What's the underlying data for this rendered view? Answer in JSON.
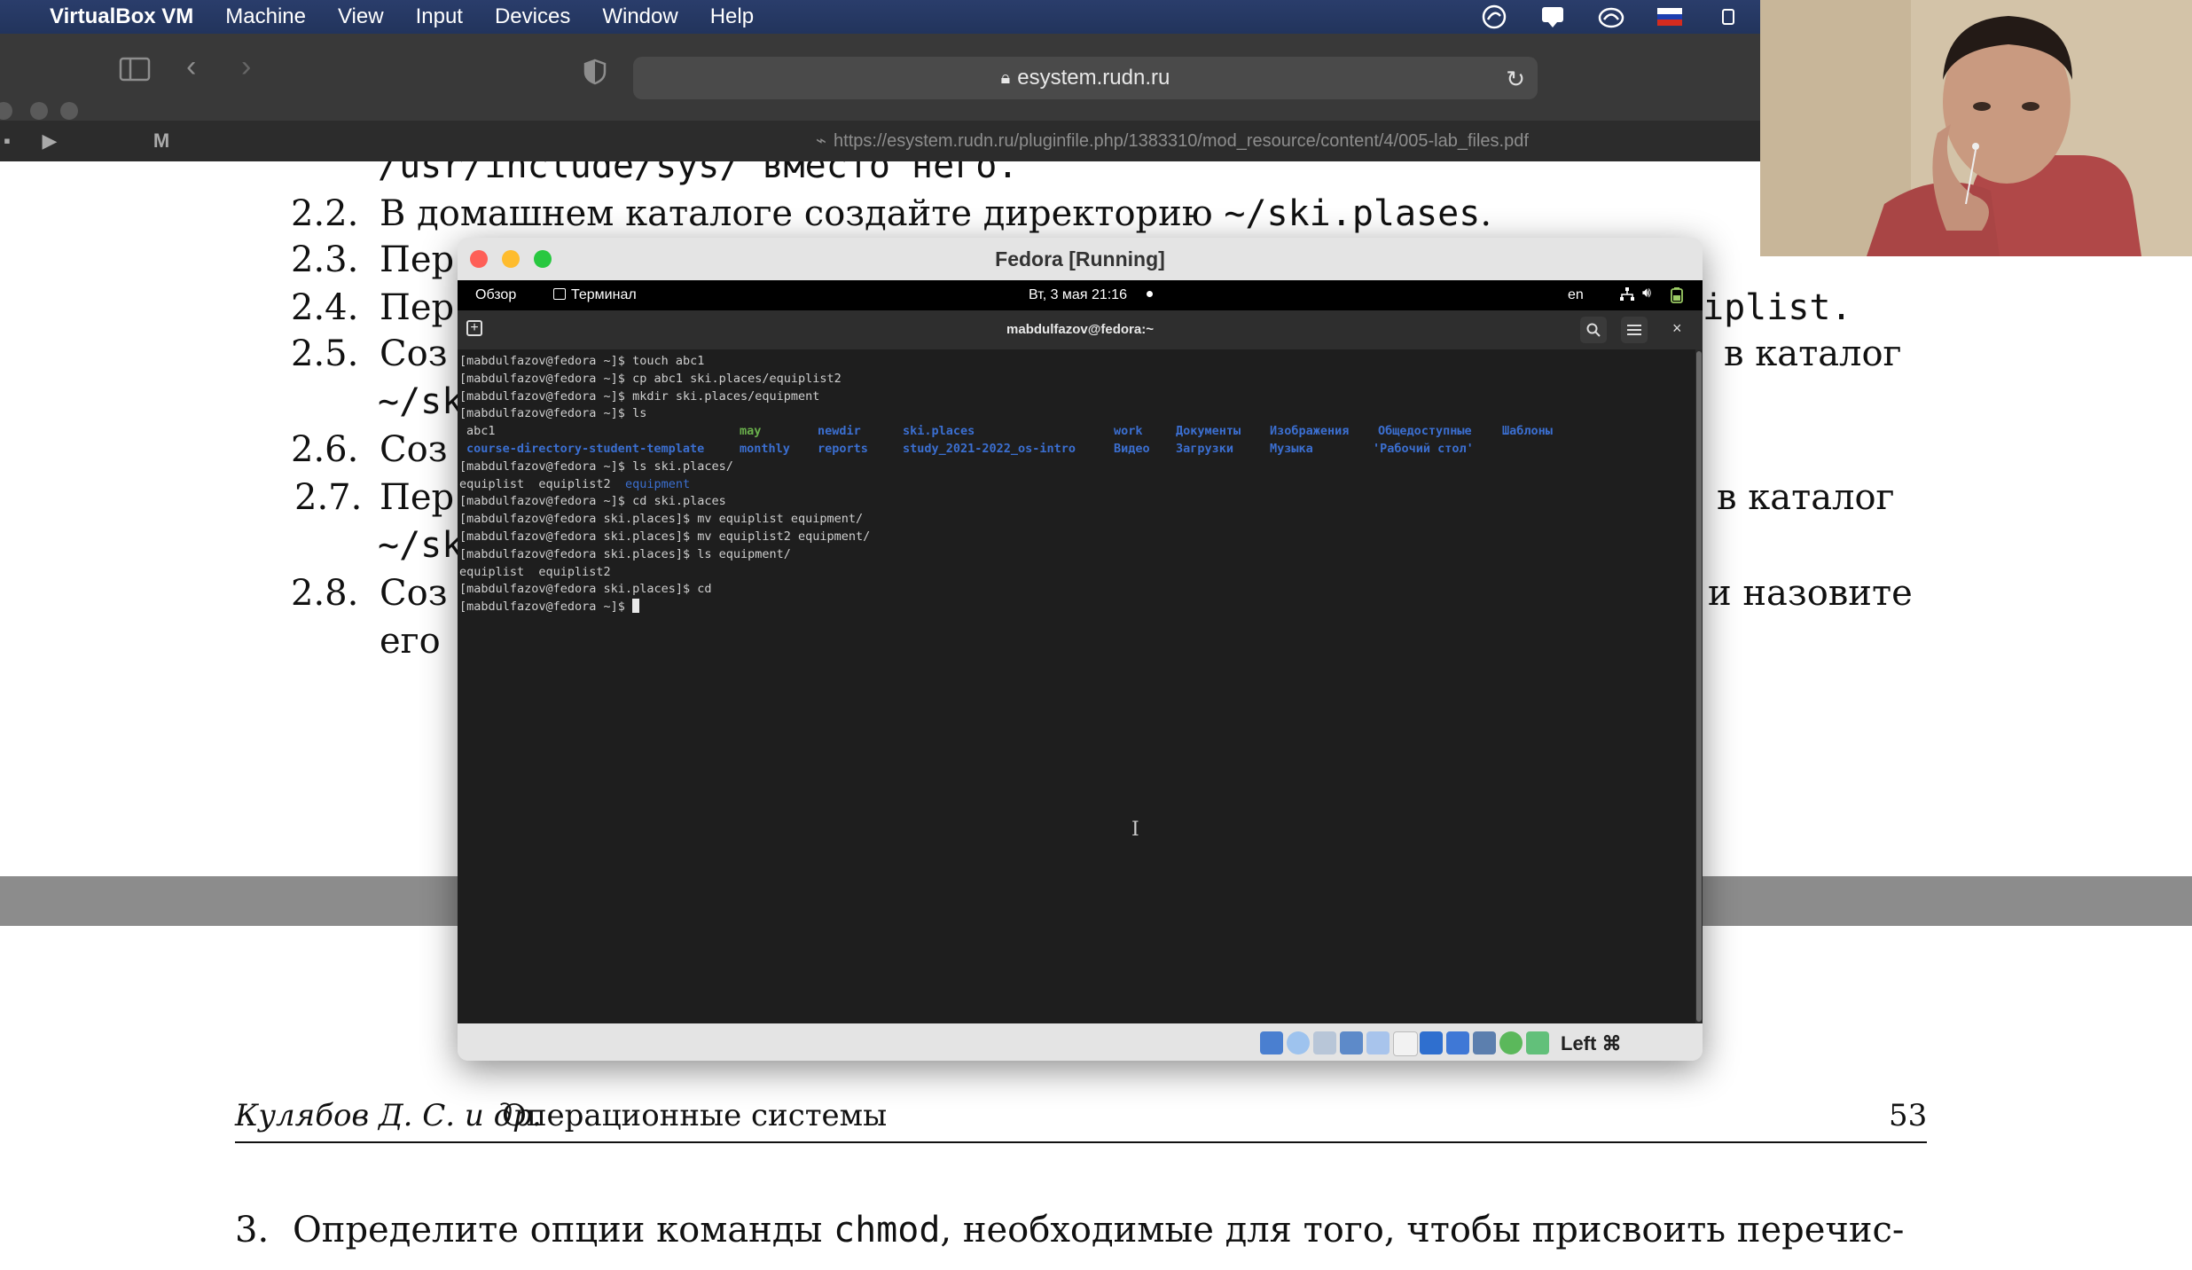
{
  "menubar": {
    "apple_glyph": "",
    "app_name": "VirtualBox VM",
    "items": [
      "Machine",
      "View",
      "Input",
      "Devices",
      "Window",
      "Help"
    ]
  },
  "browser": {
    "url": "esystem.rudn.ru",
    "hover_url": "https://esystem.rudn.ru/pluginfile.php/1383310/mod_resource/content/4/005-lab_files.pdf"
  },
  "pdf": {
    "lines": [
      {
        "num": "",
        "text": "/usr/include/sys/ вместо него."
      },
      {
        "num": "2.2.",
        "text": "В домашнем каталоге создайте директорию ~/ski.plases."
      },
      {
        "num": "2.3.",
        "text": "Пер"
      },
      {
        "num": "2.4.",
        "text": "Пер",
        "tail": "iplist."
      },
      {
        "num": "2.5.",
        "text": "Соз",
        "tail": "в   каталог"
      },
      {
        "num": "",
        "text": "~/sk"
      },
      {
        "num": "2.6.",
        "text": "Соз"
      },
      {
        "num": "2.7.",
        "text": "Пер",
        "tail": "в   каталог"
      },
      {
        "num": "",
        "text": "~/sk"
      },
      {
        "num": "2.8.",
        "text": "Соз",
        "tail": "и назовите"
      },
      {
        "num": "",
        "text": "его"
      }
    ],
    "footer_author": "Кулябов Д. С. и др.",
    "footer_title": "Операционные системы",
    "page_number": "53",
    "next_item_num": "3.",
    "next_item_text_a": "Определите опции команды ",
    "next_item_code": "chmod",
    "next_item_text_b": ", необходимые для того, чтобы присвоить перечис-"
  },
  "vbox": {
    "title": "Fedora [Running]",
    "status_right": "Left ⌘"
  },
  "gnome": {
    "overview": "Обзор",
    "terminal_app": "Терминал",
    "datetime": "Вт, 3 мая  21:16",
    "lang": "en"
  },
  "terminal": {
    "title": "mabdulfazov@fedora:~",
    "lines_before_ls": [
      "[mabdulfazov@fedora ~]$ touch abc1",
      "[mabdulfazov@fedora ~]$ cp abc1 ski.places/equiplist2",
      "[mabdulfazov@fedora ~]$ mkdir ski.places/equipment",
      "[mabdulfazov@fedora ~]$ ls"
    ],
    "ls_row1": [
      "abc1",
      "may",
      "newdir",
      "ski.places",
      "work",
      "Документы",
      "Изображения",
      "Общедоступные",
      "Шаблоны"
    ],
    "ls_row2": [
      "course-directory-student-template",
      "monthly",
      "reports",
      "study_2021-2022_os-intro",
      "Видео",
      "Загрузки",
      "Музыка",
      "'Рабочий стол'"
    ],
    "cmd_ls_ski": "[mabdulfazov@fedora ~]$ ls ski.places/",
    "ls_ski_plain": "equiplist  equiplist2",
    "ls_ski_dir": "equipment",
    "lines_after": [
      "[mabdulfazov@fedora ~]$ cd ski.places",
      "[mabdulfazov@fedora ski.places]$ mv equiplist equipment/",
      "[mabdulfazov@fedora ski.places]$ mv equiplist2 equipment/",
      "[mabdulfazov@fedora ski.places]$ ls equipment/",
      "equiplist  equiplist2",
      "[mabdulfazov@fedora ski.places]$ cd"
    ],
    "prompt": "[mabdulfazov@fedora ~]$ "
  }
}
